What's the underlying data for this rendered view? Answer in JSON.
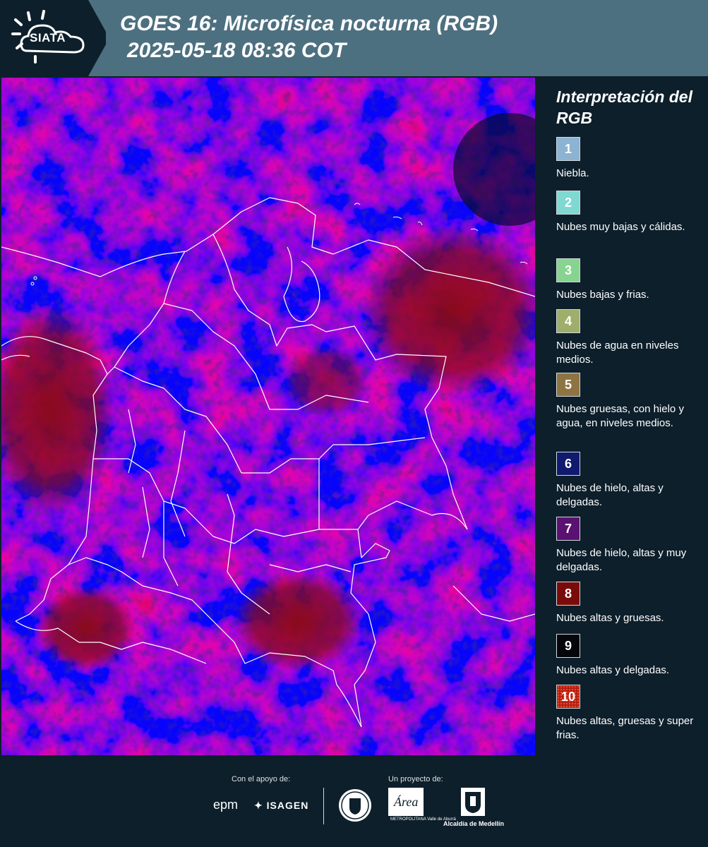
{
  "header": {
    "logo": "SIATA",
    "title_line1": "GOES 16: Microfísica nocturna (RGB)",
    "title_line2": "2025-05-18 08:36 COT"
  },
  "legend": {
    "title": "Interpretación del RGB",
    "items": [
      {
        "number": "1",
        "label": "Niebla.",
        "color": "#8db3d3"
      },
      {
        "number": "2",
        "label": "Nubes muy bajas y cálidas.",
        "color": "#7fd8d2"
      },
      {
        "number": "3",
        "label": "Nubes bajas y frias.",
        "color": "#86d48f"
      },
      {
        "number": "4",
        "label": "Nubes de agua en niveles medios.",
        "color": "#9fae6b"
      },
      {
        "number": "5",
        "label": "Nubes gruesas, con hielo y agua, en niveles medios.",
        "color": "#8f7443"
      },
      {
        "number": "6",
        "label": "Nubes de hielo, altas y delgadas.",
        "color": "#101a6e"
      },
      {
        "number": "7",
        "label": "Nubes de hielo, altas y muy delgadas.",
        "color": "#5a1172"
      },
      {
        "number": "8",
        "label": "Nubes altas y gruesas.",
        "color": "#7a0b0b"
      },
      {
        "number": "9",
        "label": "Nubes altas y delgadas.",
        "color": "#05050c"
      },
      {
        "number": "10",
        "label": "Nubes altas, gruesas y super frias.",
        "color": "#b31d10"
      }
    ]
  },
  "footer": {
    "support_caption": "Con el apoyo de:",
    "project_caption": "Un proyecto de:",
    "sponsor1": "epm",
    "sponsor2": "ISAGEN",
    "partner_area": "Área",
    "partner_area_sub": "METROPOLITANA Valle de Aburrá",
    "partner_alcaldia": "Alcaldía de Medellín"
  },
  "colors": {
    "header_band": "#4d7080",
    "background": "#0d1f2b",
    "map_blue": "#3a1cf0",
    "map_red": "#8c0a1e",
    "border_lines": "#ffffff"
  }
}
